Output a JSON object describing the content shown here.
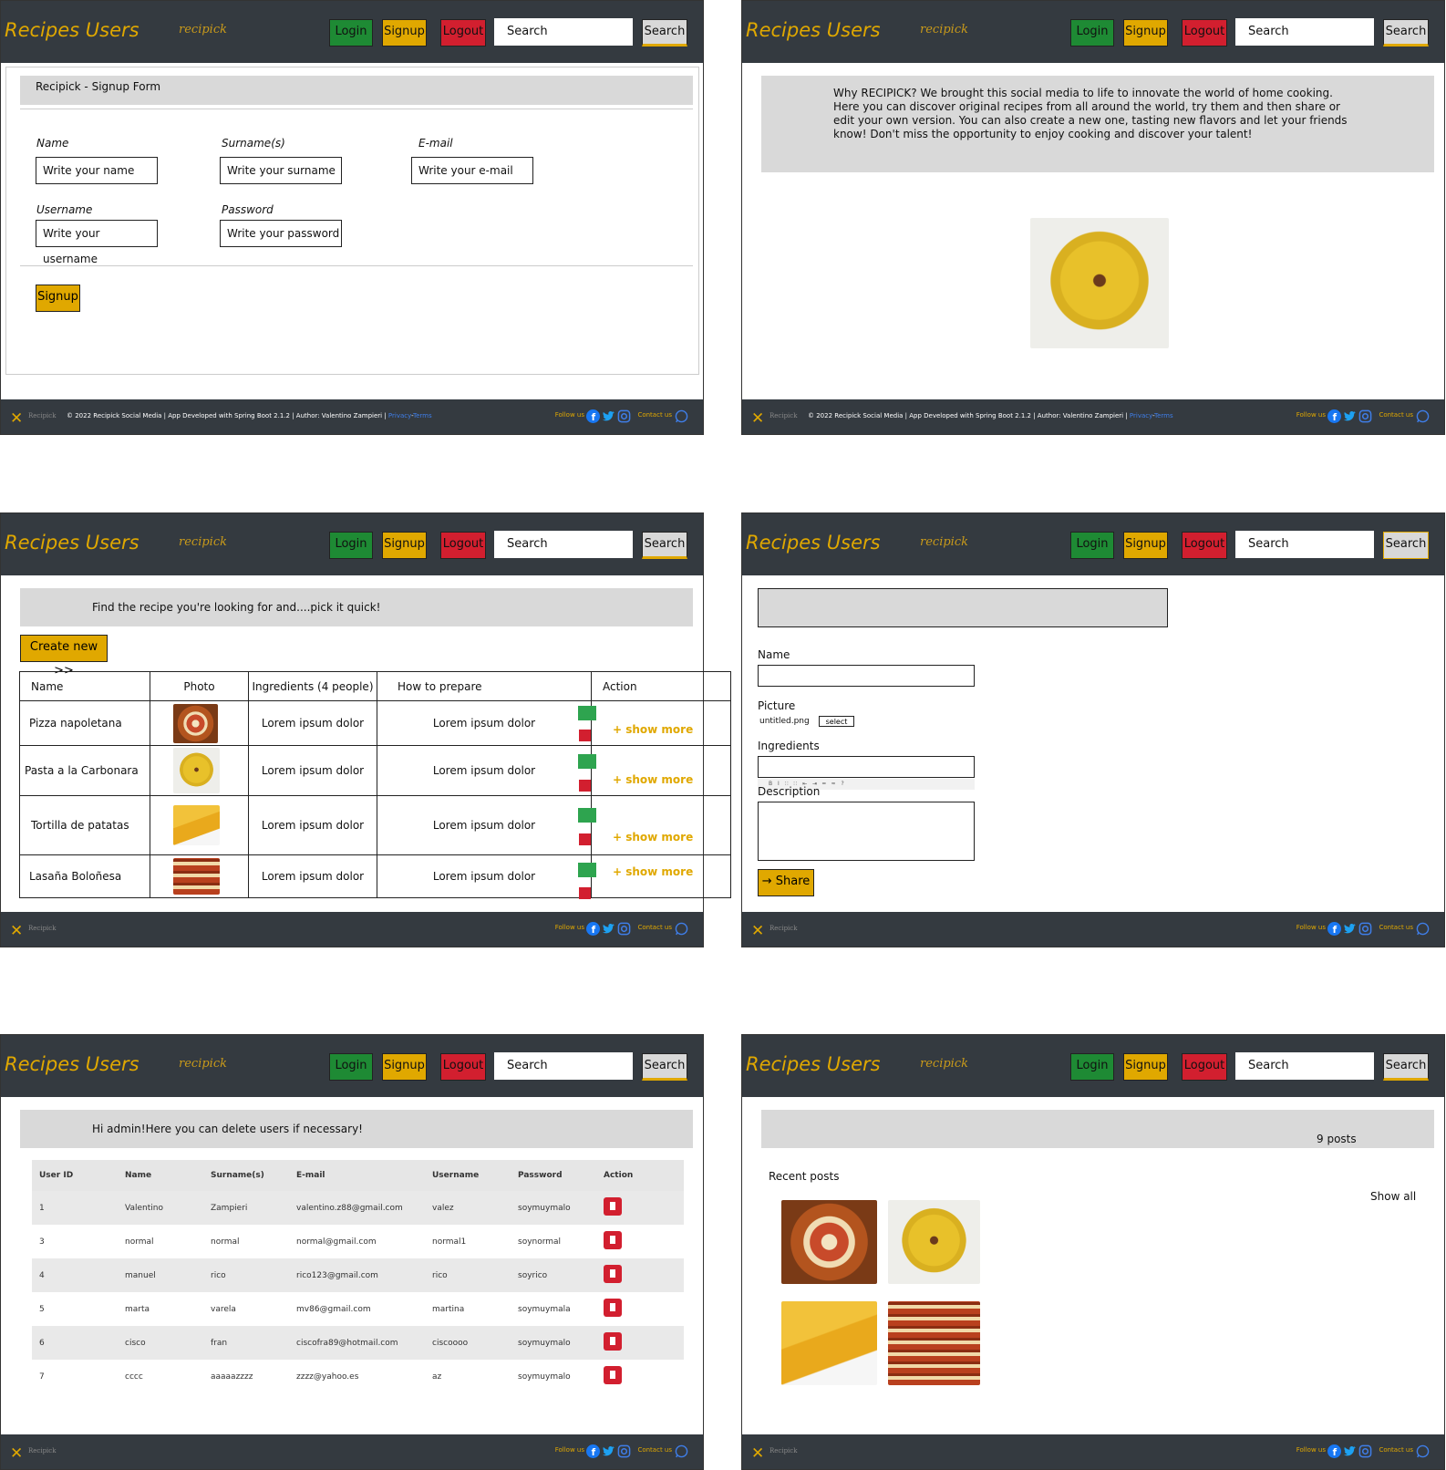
{
  "header": {
    "brand": "Recipes Users",
    "logo_text": "recipick",
    "login": "Login",
    "signup": "Signup",
    "logout": "Logout",
    "search_placeholder": "Search",
    "search_button": "Search"
  },
  "footer": {
    "logo_text": "Recipick",
    "copyright": "© 2022 Recipick Social Media | App Developed with Spring Boot 2.1.2 | Author: Valentino Zampieri |",
    "privacy": "Privacy",
    "terms": "Terms",
    "follow": "Follow us",
    "contact": "Contact us"
  },
  "signup_form": {
    "title": "Recipick - Signup Form",
    "name_label": "Name",
    "name_placeholder": "Write your name",
    "surname_label": "Surname(s)",
    "surname_placeholder": "Write your surname",
    "email_label": "E-mail",
    "email_placeholder": "Write your e-mail",
    "username_label": "Username",
    "username_placeholder": "Write your username",
    "password_label": "Password",
    "password_placeholder": "Write your password",
    "submit": "Signup"
  },
  "about": {
    "text": "Why RECIPICK? We brought this social media to life to innovate the world of home cooking. Here you can discover original recipes from all around the world, try them and then share or edit your own version. You can also create a new one, tasting new flavors and let your friends know! Don't miss the opportunity to enjoy cooking and discover your talent!"
  },
  "recipes": {
    "banner": "Find the recipe you're looking for and....pick it quick!",
    "create_new": "Create new >>",
    "columns": [
      "Name",
      "Photo",
      "Ingredients (4 people)",
      "How to prepare",
      "Action"
    ],
    "rows": [
      {
        "name": "Pizza napoletana",
        "ingredients": "Lorem ipsum dolor",
        "prepare": "Lorem ipsum dolor",
        "more": "+ show more"
      },
      {
        "name": "Pasta a la Carbonara",
        "ingredients": "Lorem ipsum dolor",
        "prepare": "Lorem ipsum dolor",
        "more": "+ show more"
      },
      {
        "name": "Tortilla de patatas",
        "ingredients": "Lorem ipsum dolor",
        "prepare": "Lorem ipsum dolor",
        "more": "+ show more"
      },
      {
        "name": "Lasaña Boloñesa",
        "ingredients": "Lorem ipsum dolor",
        "prepare": "Lorem ipsum dolor",
        "more": "+ show more"
      }
    ]
  },
  "new_recipe": {
    "name_label": "Name",
    "picture_label": "Picture",
    "file_name": "untitled.png",
    "select_button": "select",
    "ingredients_label": "Ingredients",
    "description_label": "Description",
    "share_button": "→ Share"
  },
  "admin": {
    "banner": "Hi admin!Here you can delete users if necessary!",
    "columns": [
      "User ID",
      "Name",
      "Surname(s)",
      "E-mail",
      "Username",
      "Password",
      "Action"
    ],
    "rows": [
      {
        "id": "1",
        "name": "Valentino",
        "surname": "Zampieri",
        "email": "valentino.z88@gmail.com",
        "username": "valez",
        "password": "soymuymalo"
      },
      {
        "id": "3",
        "name": "normal",
        "surname": "normal",
        "email": "normal@gmail.com",
        "username": "normal1",
        "password": "soynormal"
      },
      {
        "id": "4",
        "name": "manuel",
        "surname": "rico",
        "email": "rico123@gmail.com",
        "username": "rico",
        "password": "soyrico"
      },
      {
        "id": "5",
        "name": "marta",
        "surname": "varela",
        "email": "mv86@gmail.com",
        "username": "martina",
        "password": "soymuymala"
      },
      {
        "id": "6",
        "name": "cisco",
        "surname": "fran",
        "email": "ciscofra89@hotmail.com",
        "username": "ciscoooo",
        "password": "soymuymalo"
      },
      {
        "id": "7",
        "name": "cccc",
        "surname": "aaaaazzzz",
        "email": "zzzz@yahoo.es",
        "username": "az",
        "password": "soymuymalo"
      }
    ]
  },
  "profile": {
    "post_count": "9 posts",
    "recent_posts": "Recent posts",
    "show_all": "Show all"
  },
  "colors": {
    "header_bg": "#343a40",
    "accent": "#e0a800",
    "login": "#1e8a34",
    "logout": "#d21f2f",
    "link": "#3f7ee8"
  }
}
